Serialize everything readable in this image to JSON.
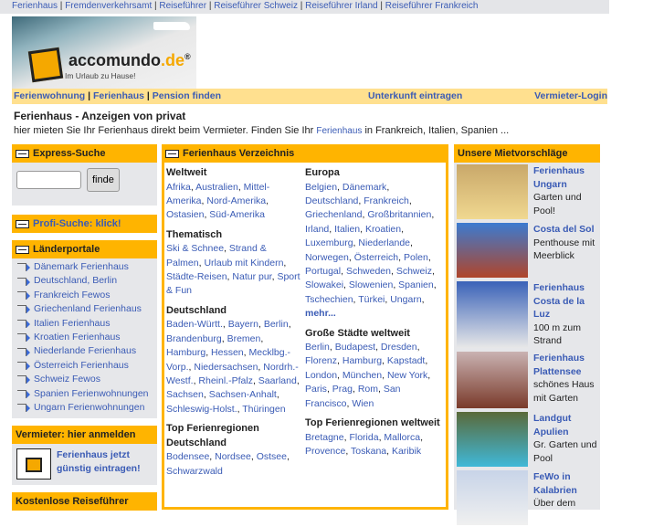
{
  "topnav": [
    "Ferienhaus",
    "Fremdenverkehrsamt",
    "Reiseführer",
    "Reiseführer Schweiz",
    "Reiseführer Irland",
    "Reiseführer Frankreich"
  ],
  "logo": {
    "name": "accomundo",
    "tld": ".de",
    "reg": "®",
    "tagline": "Im Urlaub zu Hause!"
  },
  "mainnav": {
    "left": [
      "Ferienwohnung",
      "Ferienhaus",
      "Pension finden"
    ],
    "middle": "Unterkunft eintragen",
    "right": "Vermieter-Login"
  },
  "page": {
    "title": "Ferienhaus - Anzeigen von privat",
    "intro_pre": "hier mieten Sie Ihr Ferienhaus direkt beim Vermieter. Finden Sie Ihr ",
    "intro_link": "Ferienhaus",
    "intro_post": " in Frankreich, Italien, Spanien ..."
  },
  "left": {
    "express": {
      "title": "Express-Suche",
      "input_value": "",
      "button": "finde"
    },
    "profi": "Profi-Suche: klick!",
    "laender": {
      "title": "Länderportale",
      "items": [
        "Dänemark Ferienhaus",
        "Deutschland, Berlin",
        "Frankreich Fewos",
        "Griechenland Ferienhaus",
        "Italien Ferienhaus",
        "Kroatien Ferienhaus",
        "Niederlande Ferienhaus",
        "Österreich Ferienhaus",
        "Schweiz Fewos",
        "Spanien Ferienwohnungen",
        "Ungarn Ferienwohnungen"
      ]
    },
    "vermieter": {
      "title": "Vermieter: hier anmelden",
      "link1": "Ferienhaus jetzt",
      "link2": "günstig eintragen!"
    },
    "reisefuehrer": "Kostenlose Reiseführer"
  },
  "verzeichnis": {
    "title": "Ferienhaus Verzeichnis",
    "col1": [
      {
        "heading": "Weltweit",
        "links": [
          "Afrika",
          "Australien",
          "Mittel-Amerika",
          "Nord-Amerika",
          "Ostasien",
          "Süd-Amerika"
        ]
      },
      {
        "heading": "Thematisch",
        "links": [
          "Ski & Schnee",
          "Strand & Palmen",
          "Urlaub mit Kindern",
          "Städte-Reisen",
          "Natur pur",
          "Sport & Fun"
        ]
      },
      {
        "heading": "Deutschland",
        "links": [
          "Baden-Württ.",
          "Bayern",
          "Berlin",
          "Brandenburg",
          "Bremen",
          "Hamburg",
          "Hessen",
          "Mecklbg.-Vorp.",
          "Niedersachsen",
          "Nordrh.-Westf.",
          "Rheinl.-Pfalz",
          "Saarland",
          "Sachsen",
          "Sachsen-Anhalt",
          "Schleswig-Holst.",
          "Thüringen"
        ]
      },
      {
        "heading": "Top Ferienregionen Deutschland",
        "links": [
          "Bodensee",
          "Nordsee",
          "Ostsee",
          "Schwarzwald"
        ]
      }
    ],
    "col2": [
      {
        "heading": "Europa",
        "links": [
          "Belgien",
          "Dänemark",
          "Deutschland",
          "Frankreich",
          "Griechenland",
          "Großbritannien",
          "Irland",
          "Italien",
          "Kroatien",
          "Luxemburg",
          "Niederlande",
          "Norwegen",
          "Österreich",
          "Polen",
          "Portugal",
          "Schweden",
          "Schweiz",
          "Slowakei",
          "Slowenien",
          "Spanien",
          "Tschechien",
          "Türkei",
          "Ungarn"
        ],
        "more": "mehr..."
      },
      {
        "heading": "Große Städte weltweit",
        "links": [
          "Berlin",
          "Budapest",
          "Dresden",
          "Florenz",
          "Hamburg",
          "Kapstadt",
          "London",
          "München",
          "New York",
          "Paris",
          "Prag",
          "Rom",
          "San Francisco",
          "Wien"
        ]
      },
      {
        "heading": "Top Ferienregionen weltweit",
        "links": [
          "Bretagne",
          "Florida",
          "Mallorca",
          "Provence",
          "Toskana",
          "Karibik"
        ]
      }
    ]
  },
  "suggestions": {
    "title": "Unsere Mietvorschläge",
    "items": [
      {
        "title": "Ferienhaus Ungarn",
        "desc": "Garten und Pool!",
        "colors": [
          "#c9a86a",
          "#f0d890"
        ]
      },
      {
        "title": "Costa del Sol",
        "desc": "Penthouse mit Meerblick",
        "colors": [
          "#3c7bd0",
          "#b0452a"
        ]
      },
      {
        "title": "Ferienhaus Costa de la Luz",
        "desc": "100 m zum Strand",
        "colors": [
          "#3a62b8",
          "#e8e8e8"
        ]
      },
      {
        "title": "Ferienhaus Plattensee",
        "desc": "schönes Haus mit Garten",
        "colors": [
          "#c9b2b2",
          "#7a3a2a"
        ]
      },
      {
        "title": "Landgut Apulien",
        "desc": "Gr. Garten und Pool",
        "colors": [
          "#5a6a3a",
          "#40b8d8"
        ]
      },
      {
        "title": "FeWo in Kalabrien",
        "desc": "Über dem",
        "colors": [
          "#c8d4e8",
          "#f0f0f0"
        ]
      }
    ]
  }
}
